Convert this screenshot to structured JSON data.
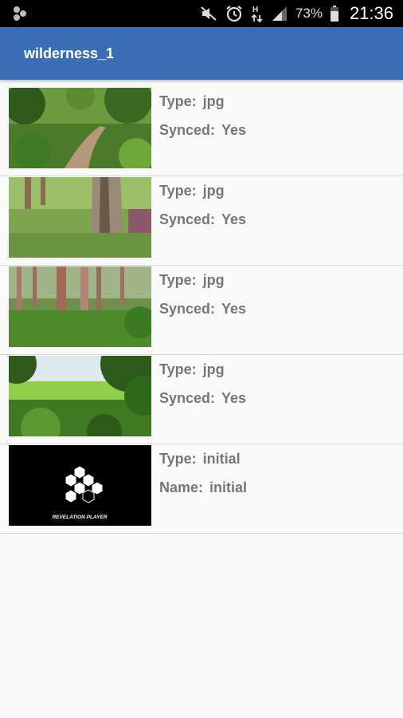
{
  "status_bar": {
    "battery_percent": "73%",
    "time": "21:36",
    "icons": [
      "app-notification-icon",
      "mute-icon",
      "alarm-icon",
      "data-transfer-icon",
      "signal-icon",
      "battery-icon"
    ]
  },
  "app_bar": {
    "title": "wilderness_1"
  },
  "items": [
    {
      "fields": [
        {
          "label": "Type:",
          "value": "jpg"
        },
        {
          "label": "Synced:",
          "value": "Yes"
        }
      ]
    },
    {
      "fields": [
        {
          "label": "Type:",
          "value": "jpg"
        },
        {
          "label": "Synced:",
          "value": "Yes"
        }
      ]
    },
    {
      "fields": [
        {
          "label": "Type:",
          "value": "jpg"
        },
        {
          "label": "Synced:",
          "value": "Yes"
        }
      ]
    },
    {
      "fields": [
        {
          "label": "Type:",
          "value": "jpg"
        },
        {
          "label": "Synced:",
          "value": "Yes"
        }
      ]
    },
    {
      "fields": [
        {
          "label": "Type:",
          "value": "initial"
        },
        {
          "label": "Name:",
          "value": "initial"
        }
      ],
      "thumb_caption": "REVELATION PLAYER"
    }
  ],
  "colors": {
    "app_bar": "#3b6db5",
    "status_bar": "#000000",
    "background": "#fafafa",
    "label_text": "#777777"
  }
}
